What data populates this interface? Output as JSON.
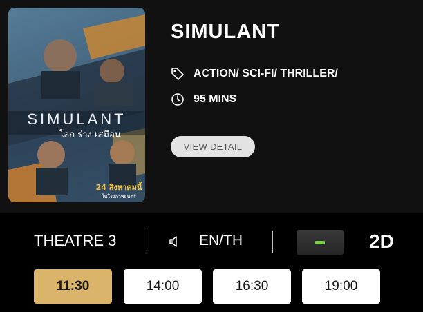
{
  "movie": {
    "title": "SIMULANT",
    "genre": "ACTION/ SCI-FI/ THRILLER/",
    "duration": "95 MINS",
    "view_detail_label": "VIEW DETAIL",
    "poster": {
      "title_text": "SIMULANT",
      "thai_title": "โลก ร่าง เสมือน",
      "release_date_thai": "24 สิงหาคมนี้",
      "release_note_thai": "ในโรงภาพยนตร์"
    }
  },
  "session": {
    "theatre": "THEATRE 3",
    "language": "EN/TH",
    "format": "2D",
    "icons": {
      "genre": "tag-icon",
      "duration": "clock-icon",
      "audio": "speaker-icon"
    },
    "format_badge_color": "#7bd143"
  },
  "showtimes": [
    {
      "time": "11:30",
      "selected": true
    },
    {
      "time": "14:00",
      "selected": false
    },
    {
      "time": "16:30",
      "selected": false
    },
    {
      "time": "19:00",
      "selected": false
    }
  ],
  "colors": {
    "background": "#000000",
    "card": "#111111",
    "selected_time": "#d9b46a",
    "button": "#ffffff",
    "view_detail_bg": "#e3e3e3"
  }
}
